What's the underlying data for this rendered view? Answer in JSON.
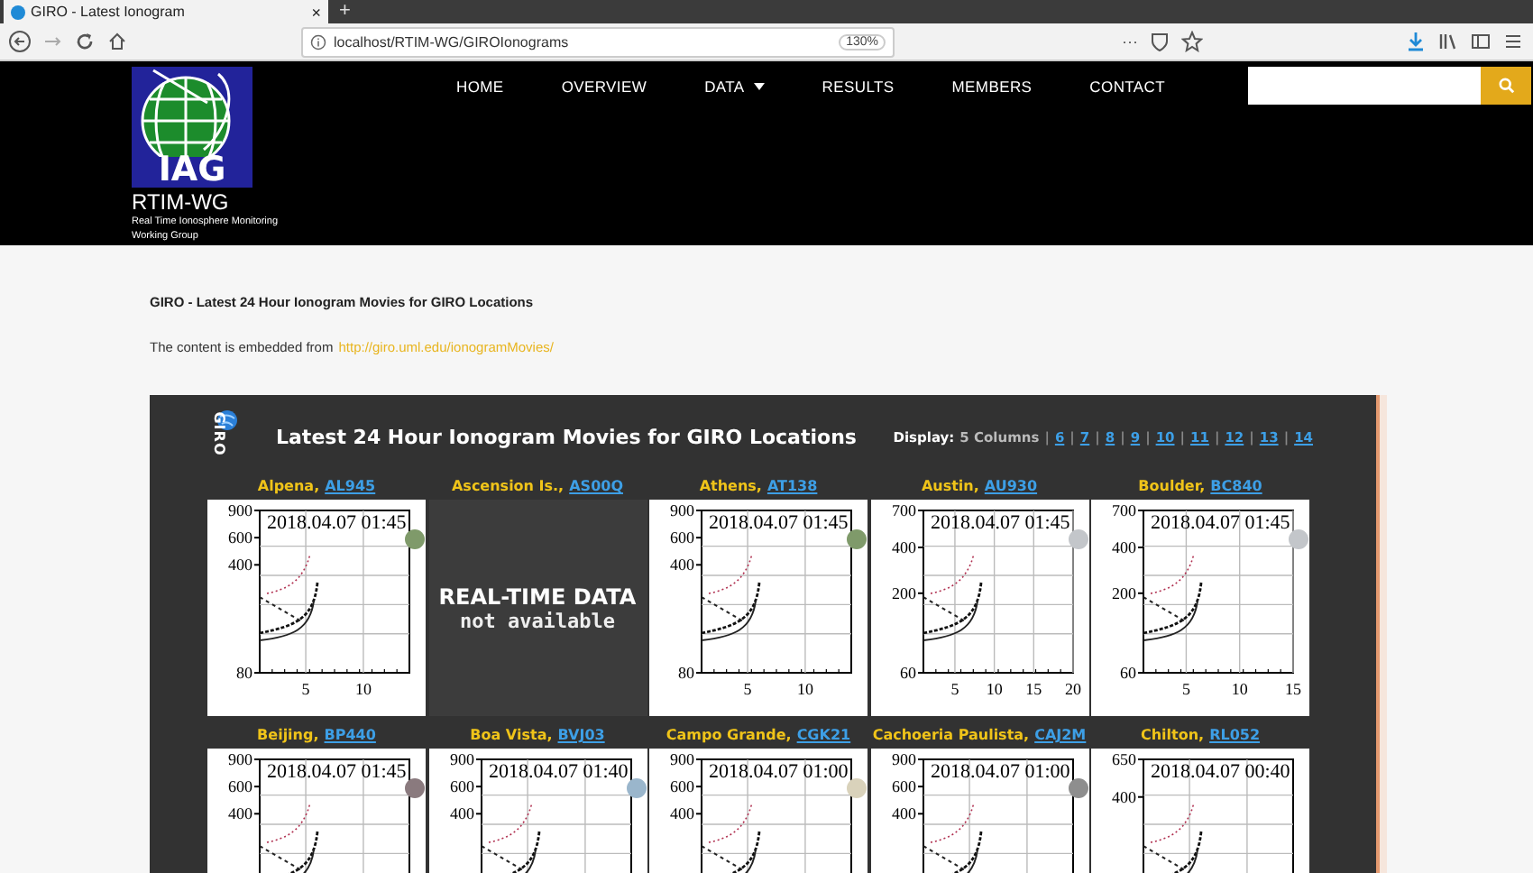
{
  "browser": {
    "tab_title": "GIRO - Latest Ionogram",
    "tab_close": "×",
    "new_tab": "+",
    "url": "localhost/RTIM-WG/GIROIonograms",
    "zoom": "130%",
    "menu": "···"
  },
  "site_header": {
    "logo_text": "IAG",
    "site_title": "RTIM-WG",
    "site_subtitle": "Real Time Ionosphere Monitoring Working Group",
    "nav": [
      {
        "label": "HOME",
        "kind": "link"
      },
      {
        "label": "OVERVIEW",
        "kind": "link"
      },
      {
        "label": "DATA",
        "kind": "dropdown"
      },
      {
        "label": "RESULTS",
        "kind": "link"
      },
      {
        "label": "MEMBERS",
        "kind": "link"
      },
      {
        "label": "CONTACT",
        "kind": "link"
      }
    ]
  },
  "content": {
    "heading": "GIRO - Latest 24 Hour Ionogram Movies for GIRO Locations",
    "intro": "The content is embedded from",
    "source_link": "http://giro.uml.edu/ionogramMovies/"
  },
  "embed": {
    "logo_text": "GIRO",
    "title": "Latest 24 Hour Ionogram Movies for GIRO Locations",
    "display": {
      "label": "Display:",
      "current": "5 Columns",
      "separator": "|",
      "options": [
        "6",
        "7",
        "8",
        "9",
        "10",
        "11",
        "12",
        "13",
        "14"
      ]
    },
    "stations": [
      {
        "name": "Alpena,",
        "code": "AL945",
        "kind": "plot",
        "timestamp": "2018.04.07 01:45",
        "y_ticks": [
          "900",
          "600",
          "400",
          "80"
        ],
        "x_ticks": [
          "5",
          "10"
        ],
        "color": "#7f9a6a"
      },
      {
        "name": "Ascension Is.,",
        "code": "AS00Q",
        "kind": "unavailable",
        "headline": "REAL-TIME DATA",
        "note": "not available"
      },
      {
        "name": "Athens,",
        "code": "AT138",
        "kind": "plot",
        "timestamp": "2018.04.07 01:45",
        "y_ticks": [
          "900",
          "600",
          "400",
          "80"
        ],
        "x_ticks": [
          "5",
          "10"
        ],
        "color": "#7f9a6a"
      },
      {
        "name": "Austin,",
        "code": "AU930",
        "kind": "plot",
        "timestamp": "2018.04.07 01:45",
        "y_ticks": [
          "700",
          "400",
          "200",
          "60"
        ],
        "x_ticks": [
          "5",
          "10",
          "15",
          "20"
        ],
        "color": "#c3c6ca"
      },
      {
        "name": "Boulder,",
        "code": "BC840",
        "kind": "plot",
        "timestamp": "2018.04.07 01:45",
        "y_ticks": [
          "700",
          "400",
          "200",
          "60"
        ],
        "x_ticks": [
          "5",
          "10",
          "15"
        ],
        "color": "#c3c6ca"
      },
      {
        "name": "Beijing,",
        "code": "BP440",
        "kind": "plot",
        "timestamp": "2018.04.07 01:45",
        "y_ticks": [
          "900",
          "600",
          "400"
        ],
        "color": "#8a7a7e"
      },
      {
        "name": "Boa Vista,",
        "code": "BVJ03",
        "kind": "plot",
        "timestamp": "2018.04.07 01:40",
        "y_ticks": [
          "900",
          "600",
          "400"
        ],
        "color": "#9ab6cc"
      },
      {
        "name": "Campo Grande,",
        "code": "CGK21",
        "kind": "plot",
        "timestamp": "2018.04.07 01:00",
        "y_ticks": [
          "900",
          "600",
          "400"
        ],
        "color": "#d9d2bb"
      },
      {
        "name": "Cachoeria Paulista,",
        "code": "CAJ2M",
        "kind": "plot",
        "timestamp": "2018.04.07 01:00",
        "y_ticks": [
          "900",
          "600",
          "400"
        ],
        "color": "#8e8e8e"
      },
      {
        "name": "Chilton,",
        "code": "RL052",
        "kind": "plot",
        "timestamp": "2018.04.07 00:40",
        "y_ticks": [
          "650",
          "400"
        ]
      }
    ]
  }
}
